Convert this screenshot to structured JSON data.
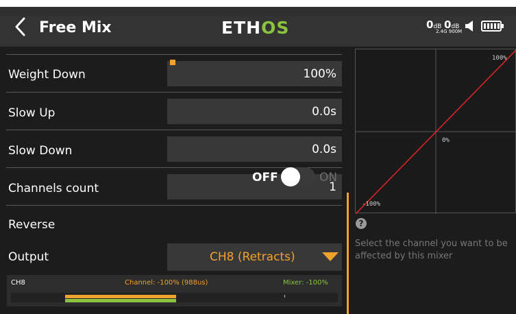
{
  "header": {
    "title": "Free Mix",
    "logo_part1": "ETH",
    "logo_part2": "OS",
    "rssi1_value": "0",
    "rssi1_unit": "dB",
    "rssi2_value": "0",
    "rssi2_unit": "dB",
    "band_label": "2.4G 900M"
  },
  "rows": {
    "weight_down": {
      "label": "Weight Down",
      "value": "100%"
    },
    "slow_up": {
      "label": "Slow Up",
      "value": "0.0s"
    },
    "slow_down": {
      "label": "Slow Down",
      "value": "0.0s"
    },
    "channels_count": {
      "label": "Channels count",
      "value": "1"
    },
    "reverse": {
      "label": "Reverse",
      "off_label": "OFF",
      "on_label": "ON",
      "state": "off"
    },
    "output": {
      "label": "Output",
      "value": "CH8 (Retracts)"
    }
  },
  "monitor": {
    "channel_name": "CH8",
    "channel_readout": "Channel: -100% (988us)",
    "mixer_readout": "Mixer: -100%"
  },
  "curve": {
    "label_top": "100%",
    "label_mid": "0%",
    "label_bottom": "-100%"
  },
  "help": {
    "icon": "?",
    "text": "Select the channel you want to be affected by this mixer"
  },
  "colors": {
    "accent": "#f0a22e",
    "green": "#8ac43f",
    "curve_line": "#e0252b"
  }
}
